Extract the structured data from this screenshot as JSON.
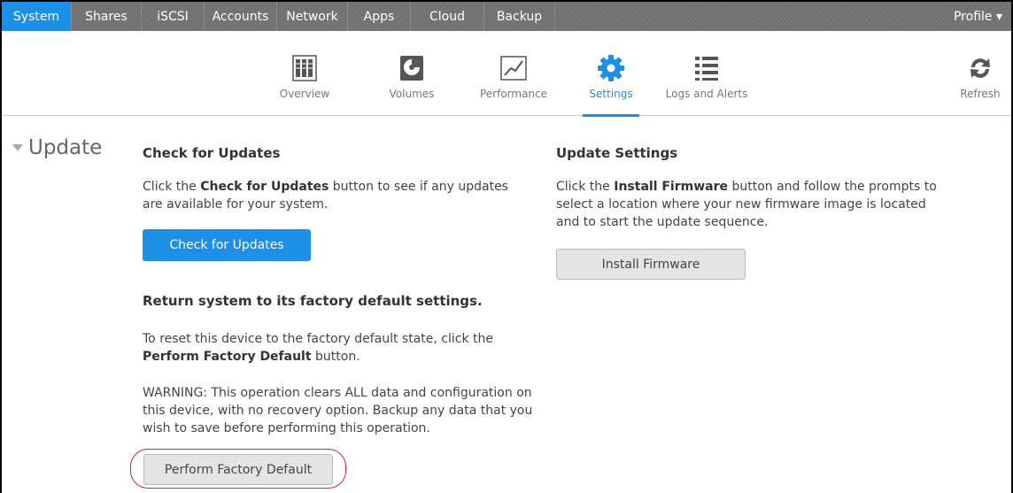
{
  "topnav": {
    "tabs": [
      "System",
      "Shares",
      "iSCSI",
      "Accounts",
      "Network",
      "Apps",
      "Cloud",
      "Backup"
    ],
    "active": "System",
    "profile": "Profile ▾"
  },
  "subnav": {
    "items": [
      {
        "label": "Overview",
        "icon": "overview-icon"
      },
      {
        "label": "Volumes",
        "icon": "volumes-icon"
      },
      {
        "label": "Performance",
        "icon": "performance-icon"
      },
      {
        "label": "Settings",
        "icon": "gear-icon"
      },
      {
        "label": "Logs and Alerts",
        "icon": "list-icon"
      }
    ],
    "active": "Settings",
    "refresh": "Refresh"
  },
  "section": {
    "title": "Update"
  },
  "check": {
    "heading": "Check for Updates",
    "desc_pre": "Click the ",
    "desc_bold": "Check for Updates",
    "desc_post": " button to see if any updates are available for your system.",
    "button": "Check for Updates"
  },
  "factory": {
    "heading": "Return system to its factory default settings.",
    "desc_pre": "To reset this device to the factory default state, click the ",
    "desc_bold": "Perform Factory Default",
    "desc_post": " button.",
    "warning": "WARNING: This operation clears ALL data and configuration on this device, with no recovery option. Backup any data that you wish to save before performing this operation.",
    "button": "Perform Factory Default"
  },
  "update_settings": {
    "heading": "Update Settings",
    "desc_pre": "Click the ",
    "desc_bold": "Install Firmware",
    "desc_post": " button and follow the prompts to select a location where your new firmware image is located and to start the update sequence.",
    "button": "Install Firmware"
  },
  "colors": {
    "accent": "#1e8fe6",
    "highlight": "#d8232a"
  }
}
